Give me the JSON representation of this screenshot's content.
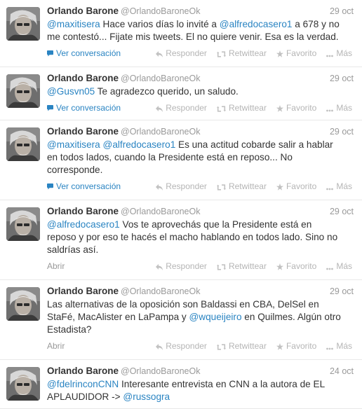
{
  "tweets": [
    {
      "name": "Orlando Barone",
      "handle": "@OrlandoBaroneOk",
      "time": "29 oct",
      "lines": [
        [
          {
            "m": "@maxitisera"
          },
          {
            "t": " Hace varios días lo invité a "
          },
          {
            "m": "@alfredocasero1"
          },
          {
            "t": " a 678 y no"
          }
        ],
        [
          {
            "t": "me contestó... Fijate mis tweets. El no quiere venir. Esa es la verdad."
          }
        ]
      ],
      "expand_label": "Ver conversación",
      "expand_type": "conversation"
    },
    {
      "name": "Orlando Barone",
      "handle": "@OrlandoBaroneOk",
      "time": "29 oct",
      "lines": [
        [
          {
            "m": "@Gusvn05"
          },
          {
            "t": " Te agradezco querido, un saludo."
          }
        ]
      ],
      "expand_label": "Ver conversación",
      "expand_type": "conversation"
    },
    {
      "name": "Orlando Barone",
      "handle": "@OrlandoBaroneOk",
      "time": "29 oct",
      "lines": [
        [
          {
            "m": "@maxitisera"
          },
          {
            "t": " "
          },
          {
            "m": "@alfredocasero1"
          },
          {
            "t": " Es una actitud cobarde salir a hablar"
          }
        ],
        [
          {
            "t": "en todos lados, cuando la Presidente está en reposo... No"
          }
        ],
        [
          {
            "t": "corresponde."
          }
        ]
      ],
      "expand_label": "Ver conversación",
      "expand_type": "conversation"
    },
    {
      "name": "Orlando Barone",
      "handle": "@OrlandoBaroneOk",
      "time": "29 oct",
      "lines": [
        [
          {
            "m": "@alfredocasero1"
          },
          {
            "t": " Vos te aprovechás que la Presidente está en"
          }
        ],
        [
          {
            "t": "reposo y por eso te hacés el macho hablando en todos lado. Sino no"
          }
        ],
        [
          {
            "t": "saldrías así."
          }
        ]
      ],
      "expand_label": "Abrir",
      "expand_type": "open"
    },
    {
      "name": "Orlando Barone",
      "handle": "@OrlandoBaroneOk",
      "time": "29 oct",
      "lines": [
        [
          {
            "t": "Las alternativas de la oposición son Baldassi en CBA, DelSel en"
          }
        ],
        [
          {
            "t": "StaFé, MacAlister en LaPampa y "
          },
          {
            "m": "@wqueijeiro"
          },
          {
            "t": " en Quilmes. Algún otro"
          }
        ],
        [
          {
            "t": "Estadista?"
          }
        ]
      ],
      "expand_label": "Abrir",
      "expand_type": "open"
    },
    {
      "name": "Orlando Barone",
      "handle": "@OrlandoBaroneOk",
      "time": "24 oct",
      "lines": [
        [
          {
            "m": "@fdelrinconCNN"
          },
          {
            "t": " Interesante entrevista en CNN a la autora de EL"
          }
        ],
        [
          {
            "t": "APLAUDIDOR -> "
          },
          {
            "m": "@russogra"
          }
        ]
      ],
      "expand_label": "",
      "expand_type": "none"
    }
  ],
  "actions": {
    "reply": "Responder",
    "retweet": "Retwittear",
    "favorite": "Favorito",
    "more": "Más"
  },
  "colors": {
    "link": "#2a84c2",
    "text": "#333333",
    "muted": "#999999",
    "action": "#b5b5b5"
  }
}
